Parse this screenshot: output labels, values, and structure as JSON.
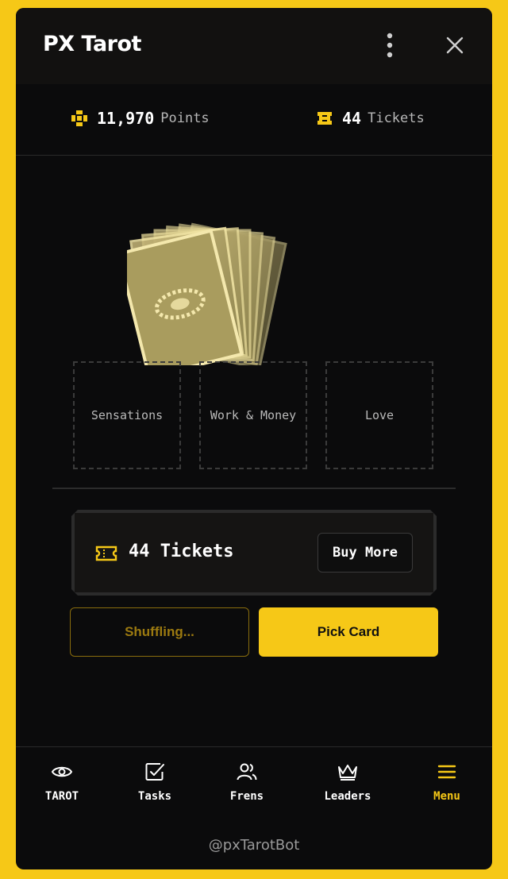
{
  "app": {
    "title": "PX Tarot"
  },
  "icons": {
    "menu_kebab": "more-vertical-icon",
    "close": "close-icon"
  },
  "stats": {
    "points": {
      "value": "11,970",
      "unit": "Points",
      "icon": "points-icon"
    },
    "tickets": {
      "value": "44",
      "unit": "Tickets",
      "icon": "ticket-icon"
    }
  },
  "deck": {
    "icon": "card-deck-icon"
  },
  "slots": [
    {
      "label": "Sensations"
    },
    {
      "label": "Work & Money"
    },
    {
      "label": "Love"
    }
  ],
  "ticket_panel": {
    "label": "44 Tickets",
    "buy_label": "Buy More"
  },
  "actions": {
    "shuffle_label": "Shuffling...",
    "pick_label": "Pick Card"
  },
  "nav": [
    {
      "label": "TAROT",
      "icon": "eye-icon",
      "active": false
    },
    {
      "label": "Tasks",
      "icon": "checkbox-icon",
      "active": false
    },
    {
      "label": "Frens",
      "icon": "users-icon",
      "active": false
    },
    {
      "label": "Leaders",
      "icon": "crown-icon",
      "active": false
    },
    {
      "label": "Menu",
      "icon": "hamburger-icon",
      "active": true
    }
  ],
  "footer": {
    "handle": "@pxTarotBot"
  },
  "colors": {
    "accent": "#f6c817",
    "background": "#0b0b0c",
    "frame": "#f6c817"
  }
}
